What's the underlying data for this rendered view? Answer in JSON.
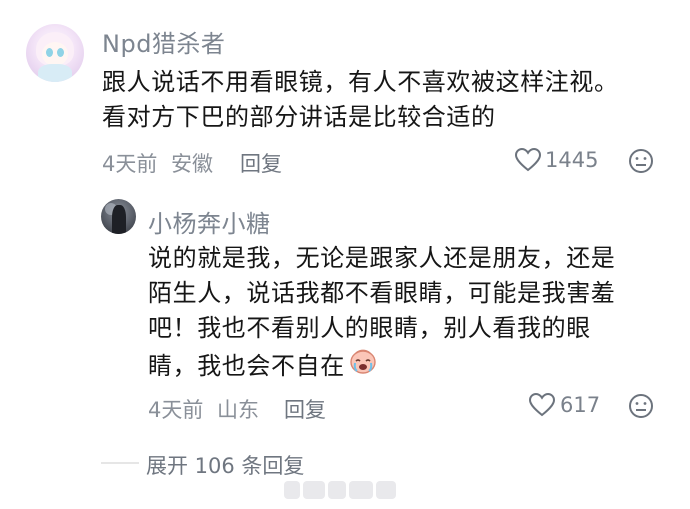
{
  "comment": {
    "username": "Npd猎杀者",
    "content_lines": [
      "跟人说话不用看眼镜，有人不喜欢被这样注视。",
      "看对方下巴的部分讲话是比较合适的"
    ],
    "time": "4天前",
    "location": "安徽",
    "reply_label": "回复",
    "likes": "1445"
  },
  "reply": {
    "username": "小杨奔小糖",
    "content_lines": [
      "说的就是我，无论是跟家人还是朋友，还是",
      "陌生人，说话我都不看眼睛，可能是我害羞",
      "吧！我也不看别人的眼睛，别人看我的眼",
      "睛，我也会不自在"
    ],
    "emoji_name": "crying-emoji",
    "time": "4天前",
    "location": "山东",
    "reply_label": "回复",
    "likes": "617"
  },
  "expand": {
    "label": "展开 106 条回复"
  },
  "icons": {
    "heart": "heart-icon",
    "dislike": "dislike-face-icon"
  },
  "colors": {
    "username": "#7d8590",
    "text": "#161616",
    "meta": "#8a9099"
  }
}
